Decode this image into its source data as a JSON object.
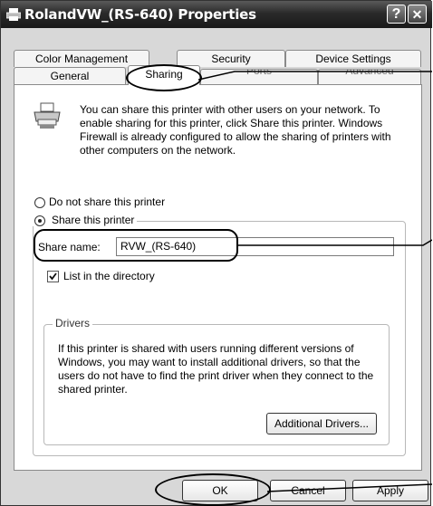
{
  "window": {
    "title": "RolandVW_(RS-640) Properties",
    "help_btn": "?",
    "close_btn": "✕"
  },
  "tabs": {
    "row1": [
      "Color Management",
      "Security",
      "Device Settings"
    ],
    "row2": [
      "General",
      "Sharing",
      "Ports",
      "Advanced"
    ],
    "active": "Sharing"
  },
  "intro_text": "You can share this printer with other users on your network.  To enable sharing for this printer, click Share this printer.  Windows Firewall is already configured to allow the sharing of printers with other computers on the network.",
  "options": {
    "do_not_share": "Do not share this printer",
    "share": "Share this printer",
    "selected": "share"
  },
  "share_name": {
    "label": "Share name:",
    "value": "RVW_(RS-640)"
  },
  "list_in_directory": {
    "label": "List in the directory",
    "checked": true
  },
  "drivers": {
    "legend": "Drivers",
    "text": "If this printer is shared with users running different versions of Windows, you may want to install additional drivers, so that the users do not have to find the print driver when they connect to the shared printer.",
    "button": "Additional Drivers..."
  },
  "buttons": {
    "ok": "OK",
    "cancel": "Cancel",
    "apply": "Apply"
  }
}
